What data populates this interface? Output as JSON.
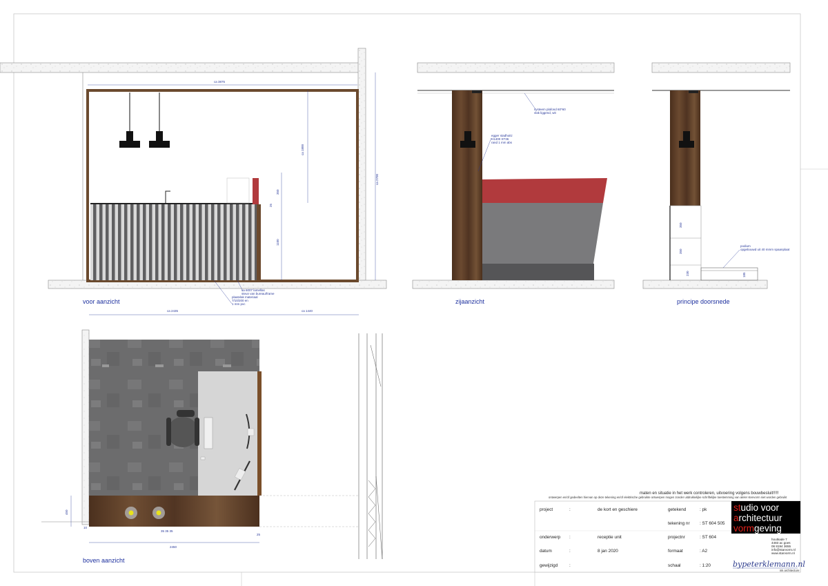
{
  "views": {
    "front": {
      "title": "voor aanzicht",
      "dim_width": "ca 3875",
      "dim_height_right": "ca 2700",
      "dim_1800": "ca 1800",
      "dim_350": "350",
      "dim_25": "25",
      "dim_1100": "1100",
      "note_lamella": [
        "ca 6007 lamellas",
        "steun van bureau/frame",
        "plaatvlak materiaal",
        "7/10/200 en",
        "1 mm pvc"
      ]
    },
    "side": {
      "title": "zijaanzicht",
      "note_ceiling": [
        "systeem plafond 60*60",
        "vlak liggend, wit"
      ],
      "note_egger": [
        "egger stadhoitz",
        "H1400 ST36",
        "rand 1 mm abs"
      ]
    },
    "section": {
      "title": "principe doorsnede",
      "dim_350a": "350",
      "dim_350b": "350",
      "dim_230": "230",
      "dim_185": "185",
      "note_podium": [
        "podium",
        "opgebouwd uit 40 mmm spaanplaat"
      ]
    },
    "top": {
      "title": "boven aanzicht",
      "dim_2435": "ca 2435",
      "dim_1440": "ca 1440",
      "dim_2450": "2450",
      "dim_25": "25",
      "dim_450": "450",
      "dim_bottom_small": "35 35 35",
      "dim_side_10": "10"
    }
  },
  "title_block": {
    "warning": "maten en situatie in het werk controleren, uitvoering volgens bouwbesluit!!!!!",
    "disclaimer": "ontwerpen en/of gedeelten hiervan op deze tekening en/of elektrische gebruikte ontwerpen mogen zonder uitdrukkelijke schriftelijke toestemming van ateler stenvorm niet worden gebruikt",
    "project_label": "project",
    "project_value": "de kort en geschiere",
    "getekend_label": "getekend",
    "getekend_value": ": pk",
    "tekeningnr_label": "tekening nr",
    "tekeningnr_value": ": ST 604 505",
    "onderwerp_label": "onderwerp",
    "onderwerp_value": "receptie unit",
    "projectnr_label": "projectnr",
    "projectnr_value": ": ST 604",
    "datum_label": "datum",
    "datum_value": "8 jan 2020",
    "formaat_label": "formaat",
    "formaat_value": ": A2",
    "gewijzigd_label": "gewijzigd",
    "schaal_label": "schaal",
    "schaal_value": ": 1:20",
    "colon": ":"
  },
  "logo": {
    "line1_red": "st",
    "line1_white": "udio voor",
    "line2_red": "a",
    "line2_white": "rchitectuur",
    "line3_red": "vorm",
    "line3_white": "geving",
    "address": [
      "houtkade 7",
      "4483 ac goes",
      "06 8194 3655",
      "info@starvorm.nl",
      "www.starvorm.nl"
    ],
    "brand": "bypeterklemann.nl",
    "brand_sub": "ink architecture"
  },
  "colors": {
    "accent_blue": "#1c2f9e",
    "wood": "#5a3a22",
    "red_top": "#b13a3d",
    "grey_panel": "#7a7a7c",
    "floor_grey": "#6f6f70"
  }
}
